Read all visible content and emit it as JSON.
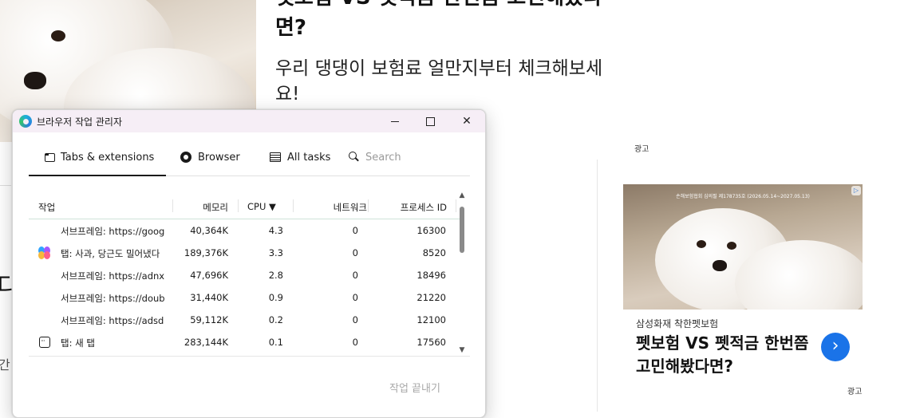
{
  "article": {
    "title": "펫보험 VS 펫적금 한번쯤 고민해봤다면?",
    "subtitle": "우리 댕댕이 보험료 얼만지부터 체크해보세요!"
  },
  "left_fragments": {
    "big": "디",
    "small": "간"
  },
  "ad": {
    "label": "광고",
    "caption": "손해보험협회 심의필 제178735호 (2026.05.14~2027.05.13)",
    "brand": "삼성화재 착한펫보험",
    "headline": "펫보험 VS 펫적금 한번쯤 고민해봤다면?",
    "cta_icon": "chevron-right-icon",
    "accent": "#1a73e8"
  },
  "task_manager": {
    "title": "브라우저 작업 관리자",
    "tabs": [
      {
        "label": "Tabs & extensions",
        "icon": "tab-icon",
        "active": true
      },
      {
        "label": "Browser",
        "icon": "edge-icon",
        "active": false
      },
      {
        "label": "All tasks",
        "icon": "list-icon",
        "active": false
      }
    ],
    "search": {
      "placeholder": "Search"
    },
    "columns": {
      "task": "작업",
      "memory": "메모리",
      "cpu": "CPU ▼",
      "network": "네트워크",
      "pid": "프로세스 ID"
    },
    "rows": [
      {
        "icon": "",
        "name": "서브프레임: https://goog",
        "memory": "40,364K",
        "cpu": "4.3",
        "network": "0",
        "pid": "16300"
      },
      {
        "icon": "copilot-icon",
        "name": "탭: 사과, 당근도 밀어냈다",
        "memory": "189,376K",
        "cpu": "3.3",
        "network": "0",
        "pid": "8520"
      },
      {
        "icon": "",
        "name": "서브프레임: https://adnx",
        "memory": "47,696K",
        "cpu": "2.8",
        "network": "0",
        "pid": "18496"
      },
      {
        "icon": "",
        "name": "서브프레임: https://doub",
        "memory": "31,440K",
        "cpu": "0.9",
        "network": "0",
        "pid": "21220"
      },
      {
        "icon": "",
        "name": "서브프레임: https://adsd",
        "memory": "59,112K",
        "cpu": "0.2",
        "network": "0",
        "pid": "12100"
      },
      {
        "icon": "new-tab-icon",
        "name": "탭: 새 탭",
        "memory": "283,144K",
        "cpu": "0.1",
        "network": "0",
        "pid": "17560"
      }
    ],
    "end_task_label": "작업 끝내기"
  }
}
